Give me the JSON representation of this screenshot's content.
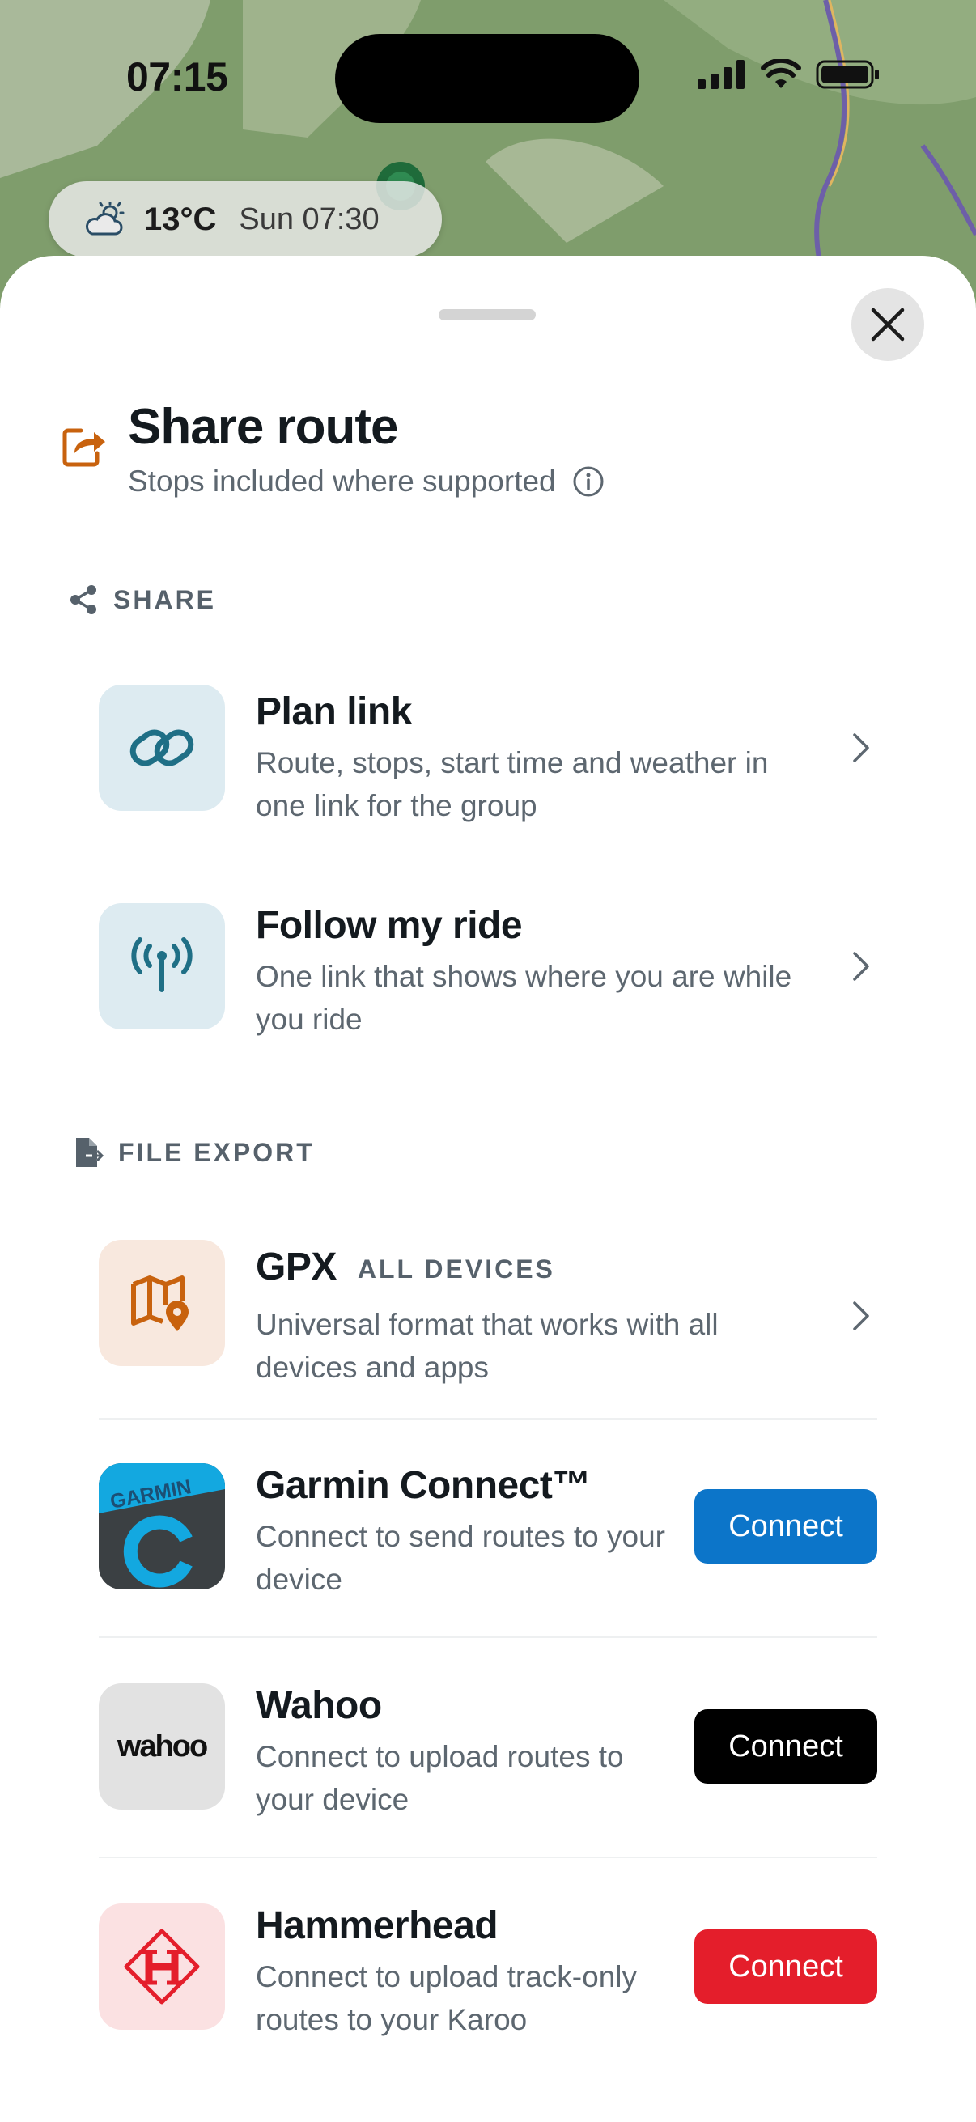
{
  "status_bar": {
    "time": "07:15"
  },
  "weather": {
    "temperature": "13°C",
    "when": "Sun 07:30",
    "icon": "partly-cloudy-icon"
  },
  "sheet": {
    "title": "Share route",
    "subtitle": "Stops included where supported",
    "share_section": {
      "label": "SHARE",
      "items": [
        {
          "title": "Plan link",
          "description": "Route, stops, start time and weather in one link for the group",
          "icon": "link-icon"
        },
        {
          "title": "Follow my ride",
          "description": "One link that shows where you are while you ride",
          "icon": "broadcast-icon"
        }
      ]
    },
    "export_section": {
      "label": "FILE EXPORT",
      "gpx": {
        "title": "GPX",
        "badge": "ALL DEVICES",
        "description": "Universal format that works with all devices and apps",
        "icon": "map-pin-icon"
      },
      "integrations": [
        {
          "title": "Garmin Connect™",
          "description": "Connect to send routes to your device",
          "logo_text": "GARMIN",
          "button": "Connect",
          "button_color": "#0c75c9"
        },
        {
          "title": "Wahoo",
          "description": "Connect to upload routes to your device",
          "logo_text": "wahoo",
          "button": "Connect",
          "button_color": "#000000"
        },
        {
          "title": "Hammerhead",
          "description": "Connect to upload track-only routes to your Karoo",
          "button": "Connect",
          "button_color": "#e41e2b"
        }
      ]
    }
  },
  "colors": {
    "accent_orange": "#c8620e",
    "teal": "#1f6f86"
  }
}
